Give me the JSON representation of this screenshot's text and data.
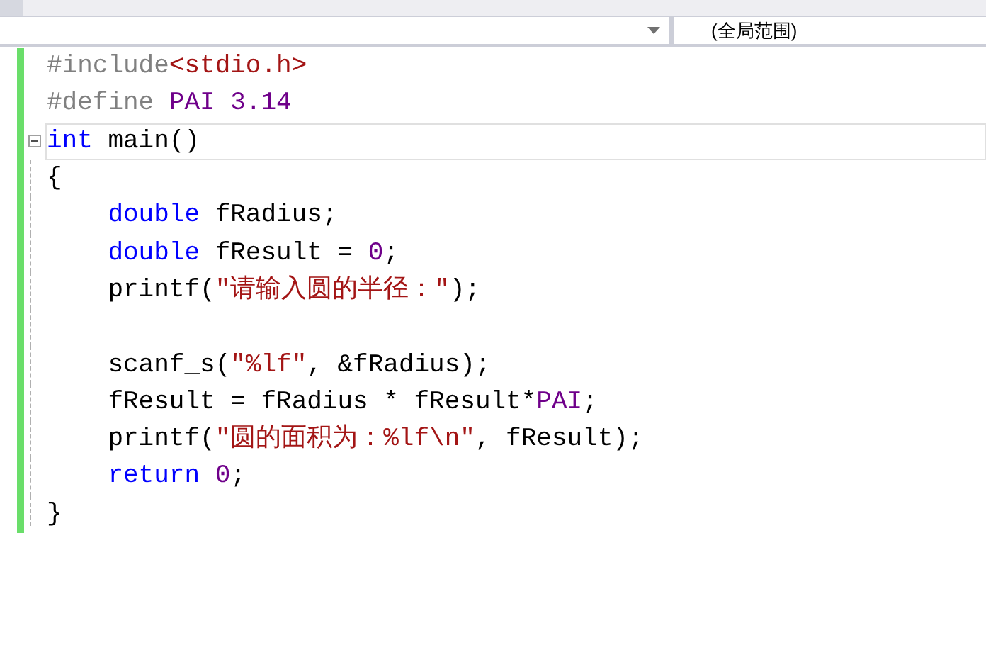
{
  "navigation_bar": {
    "scope_dropdown": {
      "value": "(全局范围)"
    }
  },
  "editor": {
    "lines": [
      {
        "tokens": [
          {
            "kind": "preprocessor",
            "text": "#include"
          },
          {
            "kind": "string",
            "text": "<stdio.h>"
          }
        ]
      },
      {
        "tokens": [
          {
            "kind": "preprocessor",
            "text": "#define "
          },
          {
            "kind": "macro",
            "text": "PAI "
          },
          {
            "kind": "number",
            "text": "3.14"
          }
        ]
      },
      {
        "fold": {
          "expanded": true
        },
        "current": true,
        "tokens": [
          {
            "kind": "keyword",
            "text": "int"
          },
          {
            "kind": "plain",
            "text": " main()"
          }
        ]
      },
      {
        "tokens": [
          {
            "kind": "plain",
            "text": "{"
          }
        ]
      },
      {
        "tokens": [
          {
            "kind": "keyword",
            "text": "    double"
          },
          {
            "kind": "plain",
            "text": " fRadius;"
          }
        ]
      },
      {
        "tokens": [
          {
            "kind": "keyword",
            "text": "    double"
          },
          {
            "kind": "plain",
            "text": " fResult = "
          },
          {
            "kind": "number",
            "text": "0"
          },
          {
            "kind": "plain",
            "text": ";"
          }
        ]
      },
      {
        "tokens": [
          {
            "kind": "plain",
            "text": "    printf("
          },
          {
            "kind": "string",
            "text": "\"请输入圆的半径：\""
          },
          {
            "kind": "plain",
            "text": ");"
          }
        ]
      },
      {
        "kind": "blank"
      },
      {
        "tokens": [
          {
            "kind": "plain",
            "text": "    scanf_s("
          },
          {
            "kind": "string",
            "text": "\"%lf\""
          },
          {
            "kind": "plain",
            "text": ", &fRadius);"
          }
        ]
      },
      {
        "tokens": [
          {
            "kind": "plain",
            "text": "    fResult = fRadius * fResult*"
          },
          {
            "kind": "macro",
            "text": "PAI"
          },
          {
            "kind": "plain",
            "text": ";"
          }
        ]
      },
      {
        "tokens": [
          {
            "kind": "plain",
            "text": "    printf("
          },
          {
            "kind": "string",
            "text": "\"圆的面积为：%lf\\n\""
          },
          {
            "kind": "plain",
            "text": ", fResult);"
          }
        ]
      },
      {
        "tokens": [
          {
            "kind": "keyword",
            "text": "    return "
          },
          {
            "kind": "number",
            "text": "0"
          },
          {
            "kind": "plain",
            "text": ";"
          }
        ]
      },
      {
        "tokens": [
          {
            "kind": "plain",
            "text": "}"
          }
        ]
      }
    ]
  }
}
